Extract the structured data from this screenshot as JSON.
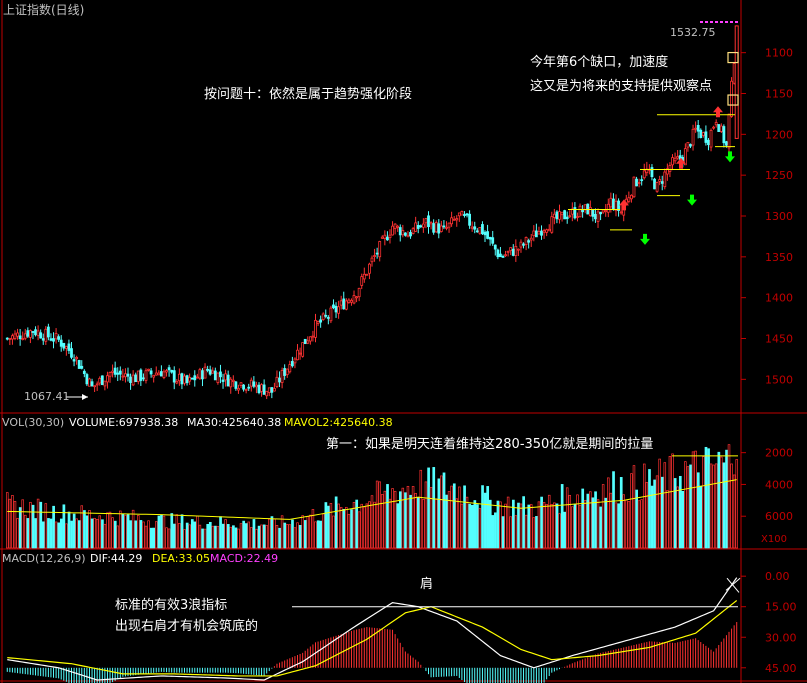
{
  "title": "上证指数(日线)",
  "colors": {
    "background": "#000000",
    "axis_red": "#c00000",
    "up": "#ff3232",
    "down": "#54ffff",
    "ma_line": "#ffff00",
    "white_line": "#ffffff",
    "purple": "#ff40ff",
    "green_arrow": "#00ff00",
    "label_grey": "#c0c0c0",
    "box_fill": "#ffe080"
  },
  "price_panel": {
    "max_label": "1532.75",
    "min_label": "1067.41",
    "y_ticks": [
      "1500",
      "1450",
      "1400",
      "1350",
      "1300",
      "1250",
      "1200",
      "1150",
      "1100"
    ],
    "annotation_main": "按问题十：依然是属于趋势强化阶段",
    "annotation_gap_1": "今年第6个缺口，加速度",
    "annotation_gap_2": "这又是为将来的支持提供观察点"
  },
  "volume_panel": {
    "header": {
      "name": "VOL(30,30)",
      "volume": "VOLUME:697938.38",
      "ma30": "MA30:425640.38",
      "mavol2": "MAVOL2:425640.38"
    },
    "y_ticks": [
      "6000",
      "4000",
      "2000"
    ],
    "unit": "X100",
    "annotation": "第一：如果是明天连着维持这280-350亿就是期间的拉量"
  },
  "macd_panel": {
    "header": {
      "name": "MACD(12,26,9)",
      "dif": "DIF:44.29",
      "dea": "DEA:33.05",
      "macd": "MACD:22.49"
    },
    "y_ticks": [
      "45.00",
      "30.00",
      "15.00",
      "0.00"
    ],
    "shoulder_label": "肩",
    "annotation_1": "标准的有效3浪指标",
    "annotation_2": "出现右肩才有机会筑底的"
  },
  "chart_data": [
    {
      "type": "candlestick",
      "title": "上证指数(日线)",
      "ylim": [
        1060,
        1540
      ],
      "y_ticks": [
        1100,
        1150,
        1200,
        1250,
        1300,
        1350,
        1400,
        1450,
        1500
      ],
      "labeled_high": 1532.75,
      "labeled_low": 1067.41,
      "close_path": [
        [
          0,
          1150
        ],
        [
          10,
          1160
        ],
        [
          20,
          1148
        ],
        [
          26,
          1130
        ],
        [
          33,
          1090
        ],
        [
          40,
          1108
        ],
        [
          50,
          1102
        ],
        [
          60,
          1110
        ],
        [
          70,
          1095
        ],
        [
          78,
          1112
        ],
        [
          87,
          1098
        ],
        [
          96,
          1092
        ],
        [
          103,
          1085
        ],
        [
          110,
          1120
        ],
        [
          120,
          1165
        ],
        [
          128,
          1185
        ],
        [
          136,
          1208
        ],
        [
          142,
          1245
        ],
        [
          150,
          1288
        ],
        [
          156,
          1278
        ],
        [
          163,
          1292
        ],
        [
          170,
          1282
        ],
        [
          176,
          1300
        ],
        [
          185,
          1282
        ],
        [
          192,
          1250
        ],
        [
          200,
          1262
        ],
        [
          210,
          1290
        ],
        [
          218,
          1302
        ],
        [
          226,
          1308
        ],
        [
          231,
          1295
        ],
        [
          235,
          1318
        ],
        [
          239,
          1305
        ],
        [
          244,
          1340
        ],
        [
          249,
          1355
        ],
        [
          253,
          1335
        ],
        [
          258,
          1362
        ],
        [
          263,
          1372
        ],
        [
          268,
          1405
        ],
        [
          273,
          1395
        ],
        [
          276,
          1420
        ],
        [
          280,
          1385
        ],
        [
          284,
          1530
        ]
      ],
      "volume": {
        "type": "bar",
        "ylim": [
          0,
          7300
        ],
        "y_ticks": [
          2000,
          4000,
          6000
        ],
        "unit": "X100",
        "volume_path": [
          [
            0,
            2700
          ],
          [
            20,
            2200
          ],
          [
            40,
            2000
          ],
          [
            60,
            1700
          ],
          [
            80,
            1600
          ],
          [
            100,
            1500
          ],
          [
            110,
            1600
          ],
          [
            130,
            2600
          ],
          [
            145,
            3300
          ],
          [
            160,
            4000
          ],
          [
            175,
            3800
          ],
          [
            190,
            2800
          ],
          [
            205,
            2500
          ],
          [
            220,
            3300
          ],
          [
            235,
            3800
          ],
          [
            250,
            4200
          ],
          [
            265,
            4900
          ],
          [
            280,
            5300
          ],
          [
            284,
            6980
          ]
        ],
        "ma_path": [
          [
            0,
            2300
          ],
          [
            60,
            2100
          ],
          [
            110,
            1800
          ],
          [
            160,
            3200
          ],
          [
            200,
            2500
          ],
          [
            240,
            3000
          ],
          [
            284,
            4300
          ]
        ]
      },
      "macd": {
        "ylim": [
          -6,
          50
        ],
        "y_ticks": [
          0,
          15,
          30,
          45
        ],
        "dif": 44.29,
        "dea": 33.05,
        "macd": 22.49,
        "dif_path": [
          [
            0,
            4
          ],
          [
            20,
            0
          ],
          [
            35,
            -6
          ],
          [
            60,
            -4
          ],
          [
            85,
            -5
          ],
          [
            100,
            -6
          ],
          [
            115,
            3
          ],
          [
            135,
            20
          ],
          [
            150,
            32
          ],
          [
            160,
            30
          ],
          [
            175,
            23
          ],
          [
            192,
            6
          ],
          [
            205,
            0
          ],
          [
            220,
            6
          ],
          [
            240,
            13
          ],
          [
            260,
            20
          ],
          [
            275,
            28
          ],
          [
            284,
            44.29
          ]
        ],
        "dea_path": [
          [
            0,
            5
          ],
          [
            25,
            2
          ],
          [
            45,
            -3
          ],
          [
            65,
            -3
          ],
          [
            90,
            -4
          ],
          [
            105,
            -4
          ],
          [
            120,
            1
          ],
          [
            140,
            14
          ],
          [
            155,
            27
          ],
          [
            165,
            30
          ],
          [
            185,
            20
          ],
          [
            200,
            9
          ],
          [
            212,
            4
          ],
          [
            230,
            6
          ],
          [
            250,
            10
          ],
          [
            268,
            17
          ],
          [
            284,
            33.05
          ]
        ]
      }
    }
  ]
}
